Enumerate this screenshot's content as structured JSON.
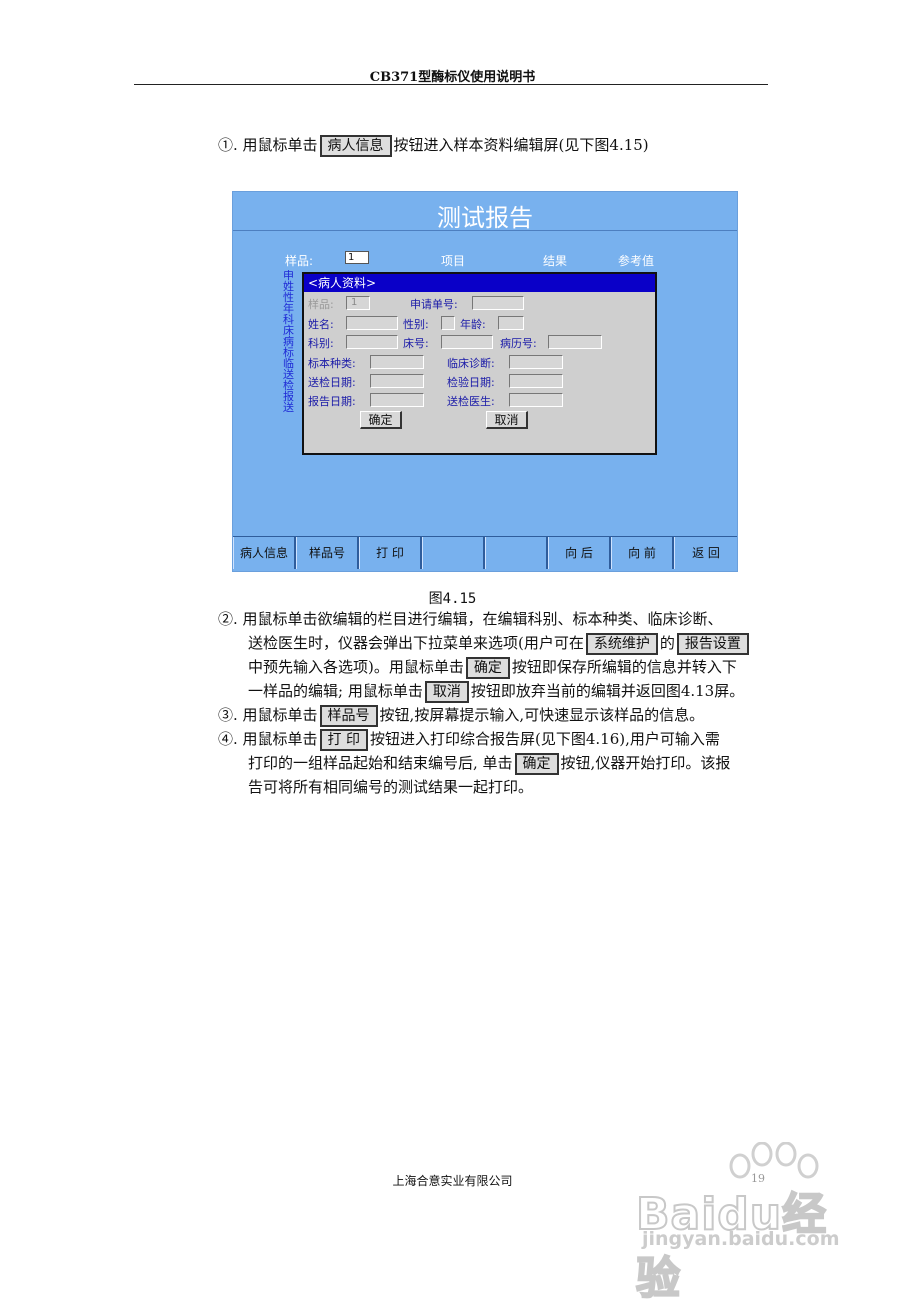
{
  "header": {
    "title": "CB371型酶标仪使用说明书"
  },
  "steps": {
    "s1": {
      "a": "①. 用鼠标单击",
      "btn": "病人信息",
      "b": "按钮进入样本资料编辑屏(见下图4.15)"
    },
    "s2": {
      "l1": "②. 用鼠标单击欲编辑的栏目进行编辑，在编辑科别、标本种类、临床诊断、",
      "l2a": "送检医生时，仪器会弹出下拉菜单来选项(用户可在",
      "btn1": "系统维护",
      "l2b": "的",
      "btn2": "报告设置",
      "l3a": "中预先输入各选项)。用鼠标单击",
      "btn3": "确定",
      "l3b": "按钮即保存所编辑的信息并转入下",
      "l4a": "一样品的编辑; 用鼠标单击",
      "btn4": "取消",
      "l4b": "按钮即放弃当前的编辑并返回图4.13屏。"
    },
    "s3": {
      "a": "③. 用鼠标单击",
      "btn": "样品号",
      "b": "按钮,按屏幕提示输入,可快速显示该样品的信息。"
    },
    "s4": {
      "a": "④. 用鼠标单击",
      "btn": "打 印",
      "b": "按钮进入打印综合报告屏(见下图4.16),用户可输入需",
      "l2a": "打印的一组样品起始和结束编号后, 单击",
      "btn2": "确定",
      "l2b": "按钮,仪器开始打印。该报",
      "l3": "告可将所有相同编号的测试结果一起打印。"
    }
  },
  "figure": {
    "title": "测试报告",
    "sample_label": "样品:",
    "sample_value": "1",
    "col_item": "项目",
    "col_result": "结果",
    "col_ref": "参考值",
    "side_text": "申姓性年科床病标临送检报送",
    "dialog": {
      "title": "<病人资料>",
      "sample_label": "样品:",
      "sample_value": "1",
      "apply_no": "申请单号:",
      "name": "姓名:",
      "sex": "性别:",
      "age": "年龄:",
      "dept": "科别:",
      "bed": "床号:",
      "record": "病历号:",
      "specimen": "标本种类:",
      "diagnosis": "临床诊断:",
      "send_date": "送检日期:",
      "test_date": "检验日期:",
      "report_date": "报告日期:",
      "doctor": "送检医生:",
      "ok": "确定",
      "cancel": "取消"
    },
    "buttons": [
      "病人信息",
      "样品号",
      "打  印",
      "",
      "",
      "向  后",
      "向  前",
      "返  回"
    ]
  },
  "caption": "图4.15",
  "footer": {
    "company": "上海合意实业有限公司",
    "page": "19"
  },
  "watermark": {
    "brand": "Baidu经验",
    "url": "jingyan.baidu.com"
  }
}
